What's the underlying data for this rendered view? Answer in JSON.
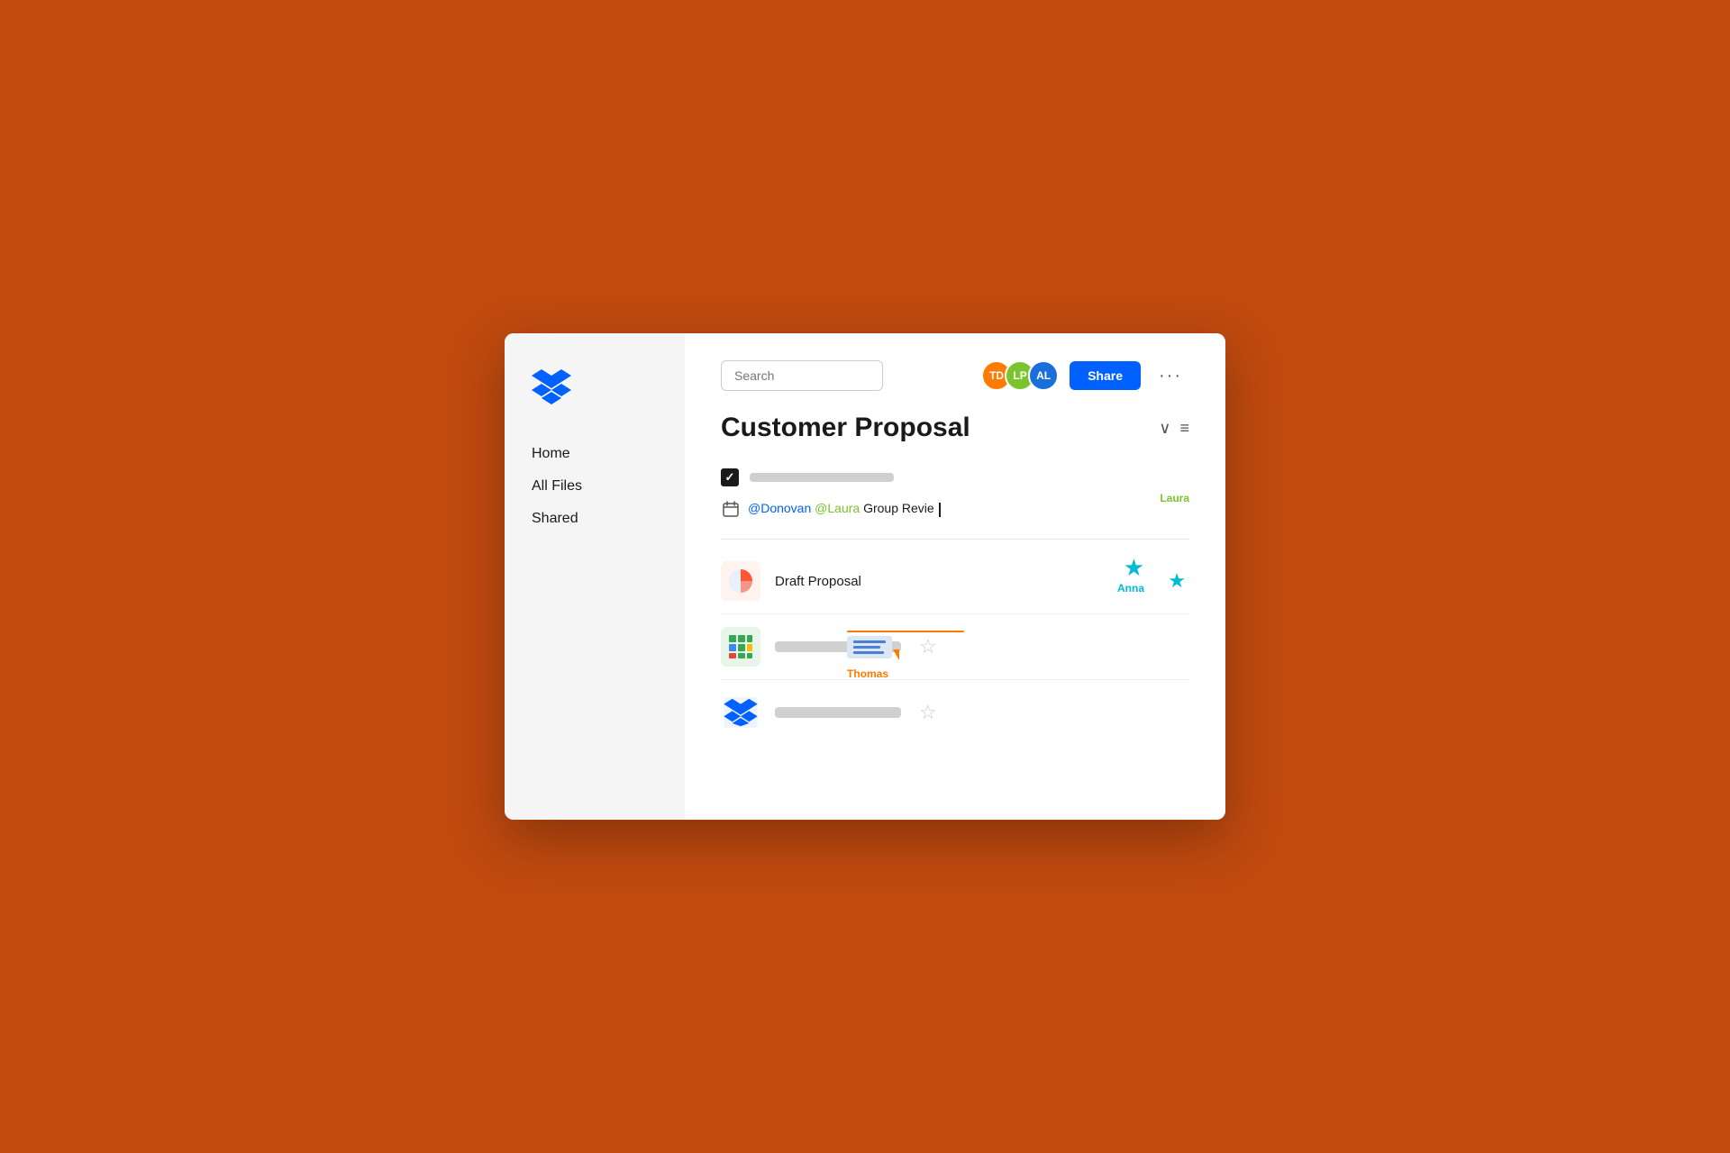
{
  "background_color": "#C14A0F",
  "sidebar": {
    "logo_alt": "Dropbox logo",
    "nav_items": [
      {
        "id": "home",
        "label": "Home"
      },
      {
        "id": "all-files",
        "label": "All Files"
      },
      {
        "id": "shared",
        "label": "Shared"
      }
    ]
  },
  "header": {
    "search_placeholder": "Search",
    "avatars": [
      {
        "initials": "TD",
        "color": "#FF7A00",
        "name": "TD"
      },
      {
        "initials": "LP",
        "color": "#7BC42D",
        "name": "LP"
      },
      {
        "initials": "AL",
        "color": "#1A6FDB",
        "name": "AL"
      }
    ],
    "share_button": "Share",
    "more_button": "···"
  },
  "document": {
    "title": "Customer Proposal",
    "task_placeholder": "",
    "mention_text_before": "@Donovan",
    "mention_text_before2": "@Laura",
    "mention_text_after": "Group Revie",
    "laura_annotation": "Laura",
    "anna_annotation": "Anna",
    "thomas_annotation": "Thomas"
  },
  "files": [
    {
      "id": "draft-proposal",
      "name": "Draft Proposal",
      "icon_type": "pie-chart",
      "starred": true
    },
    {
      "id": "sheets-file",
      "name": "",
      "icon_type": "sheets",
      "starred": false
    },
    {
      "id": "dropbox-file",
      "name": "",
      "icon_type": "dropbox",
      "starred": false
    }
  ],
  "icons": {
    "chevron_down": "∨",
    "hamburger": "≡",
    "star_empty": "☆",
    "star_filled": "★",
    "checkbox_checked": "✓"
  }
}
